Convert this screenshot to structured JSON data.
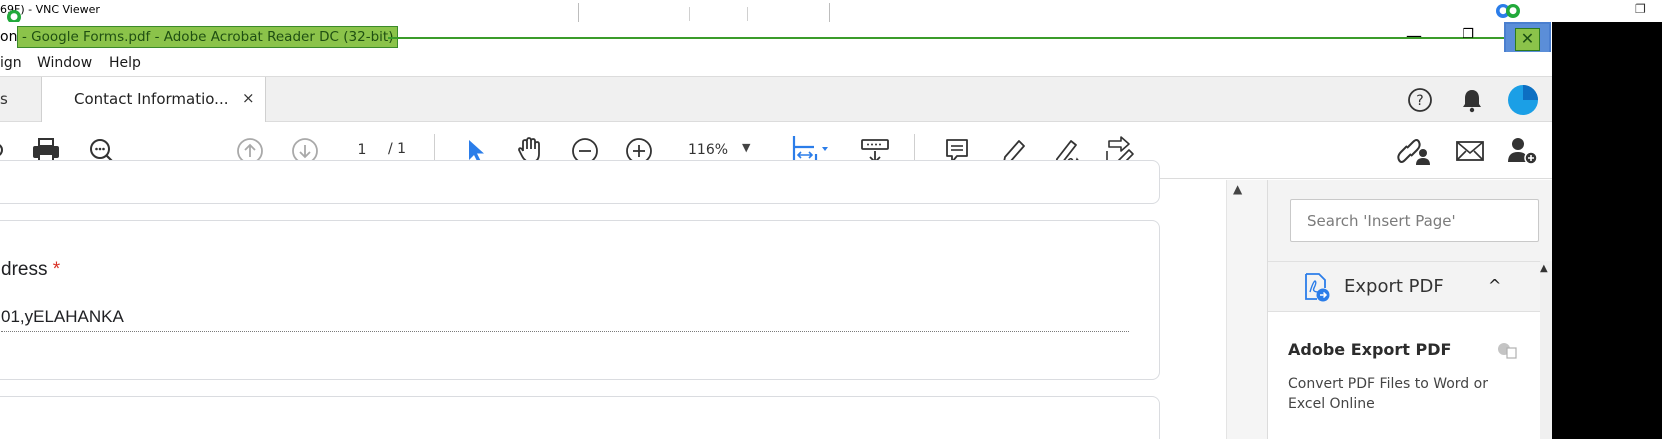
{
  "vnc": {
    "title": "69F) - VNC Viewer"
  },
  "window": {
    "title_prefix": "on",
    "title_highlight": "- Google Forms.pdf - Adobe Acrobat Reader DC (32-bit)",
    "minimize": "—",
    "maximize": "❐",
    "close": "✕"
  },
  "menu": {
    "items": [
      "ign",
      "Window",
      "Help"
    ]
  },
  "tabs": {
    "prev_label": "s",
    "active_label": "Contact Informatio...",
    "active_close": "×"
  },
  "toolbar": {
    "page_current": "1",
    "page_total": "/ 1",
    "zoom": "116%",
    "zoom_caret": "▼"
  },
  "form": {
    "address_label": "dress",
    "required_mark": "*",
    "address_value": "01,yELAHANKA"
  },
  "right_panel": {
    "search_placeholder": "Search 'Insert Page'",
    "export_title": "Export PDF",
    "export_chevron": "^",
    "export_heading": "Adobe Export PDF",
    "export_desc": "Convert PDF Files to Word or Excel Online"
  },
  "colors": {
    "accent_blue": "#2b7de9",
    "title_highlight": "#8bc34a",
    "required_red": "#d93025"
  }
}
